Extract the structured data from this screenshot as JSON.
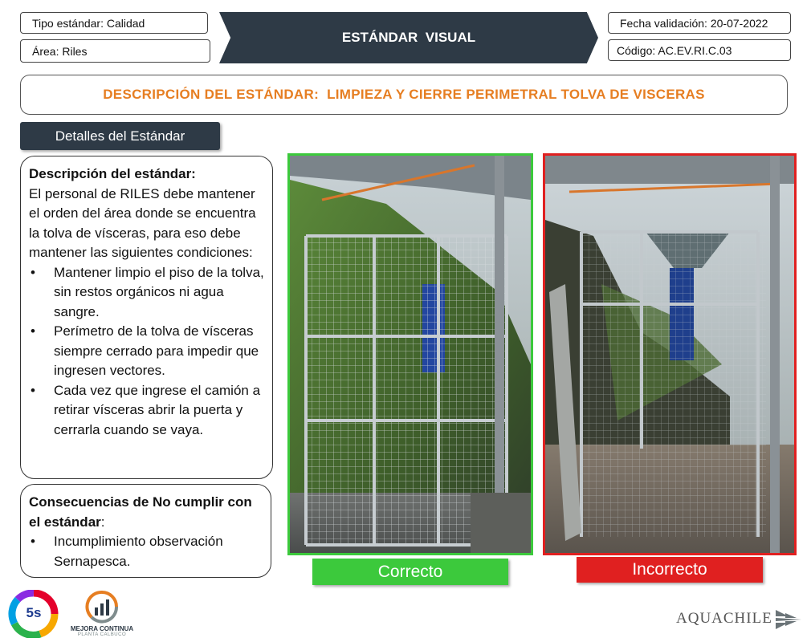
{
  "header": {
    "tipo": "Tipo estándar: Calidad",
    "area": "Área: Riles",
    "title": "ESTÁNDAR  VISUAL",
    "fecha": "Fecha validación: 20-07-2022",
    "codigo": "Código: AC.EV.RI.C.03"
  },
  "description_title": "DESCRIPCIÓN DEL ESTÁNDAR:  LIMPIEZA Y CIERRE PERIMETRAL TOLVA DE VISCERAS",
  "details_tab": "Detalles del Estándar",
  "standard": {
    "heading": "Descripción del estándar:",
    "intro": "El personal de RILES debe mantener el orden del área donde se encuentra la tolva de vísceras, para eso debe mantener las siguientes condiciones:",
    "bullets": [
      "Mantener limpio el piso de la tolva, sin restos orgánicos ni agua sangre.",
      "Perímetro de la tolva de vísceras siempre cerrado para impedir que ingresen vectores.",
      "Cada vez que ingrese el camión a retirar vísceras abrir la puerta y cerrarla cuando se vaya."
    ]
  },
  "consequences": {
    "heading": "Consecuencias de No cumplir con el estándar",
    "colon": ":",
    "bullets": [
      "Incumplimiento observación Sernapesca."
    ]
  },
  "photos": {
    "correct_label": "Correcto",
    "incorrect_label": "Incorrecto"
  },
  "logos": {
    "five_s": "5s",
    "mejora_line1": "MEJORA CONTINUA",
    "mejora_line2": "PLANTA CALBUCO",
    "brand": "AQUACHILE"
  },
  "colors": {
    "navy": "#2e3a46",
    "orange_title": "#e67e22",
    "correct": "#3cc93c",
    "incorrect": "#e02020"
  }
}
